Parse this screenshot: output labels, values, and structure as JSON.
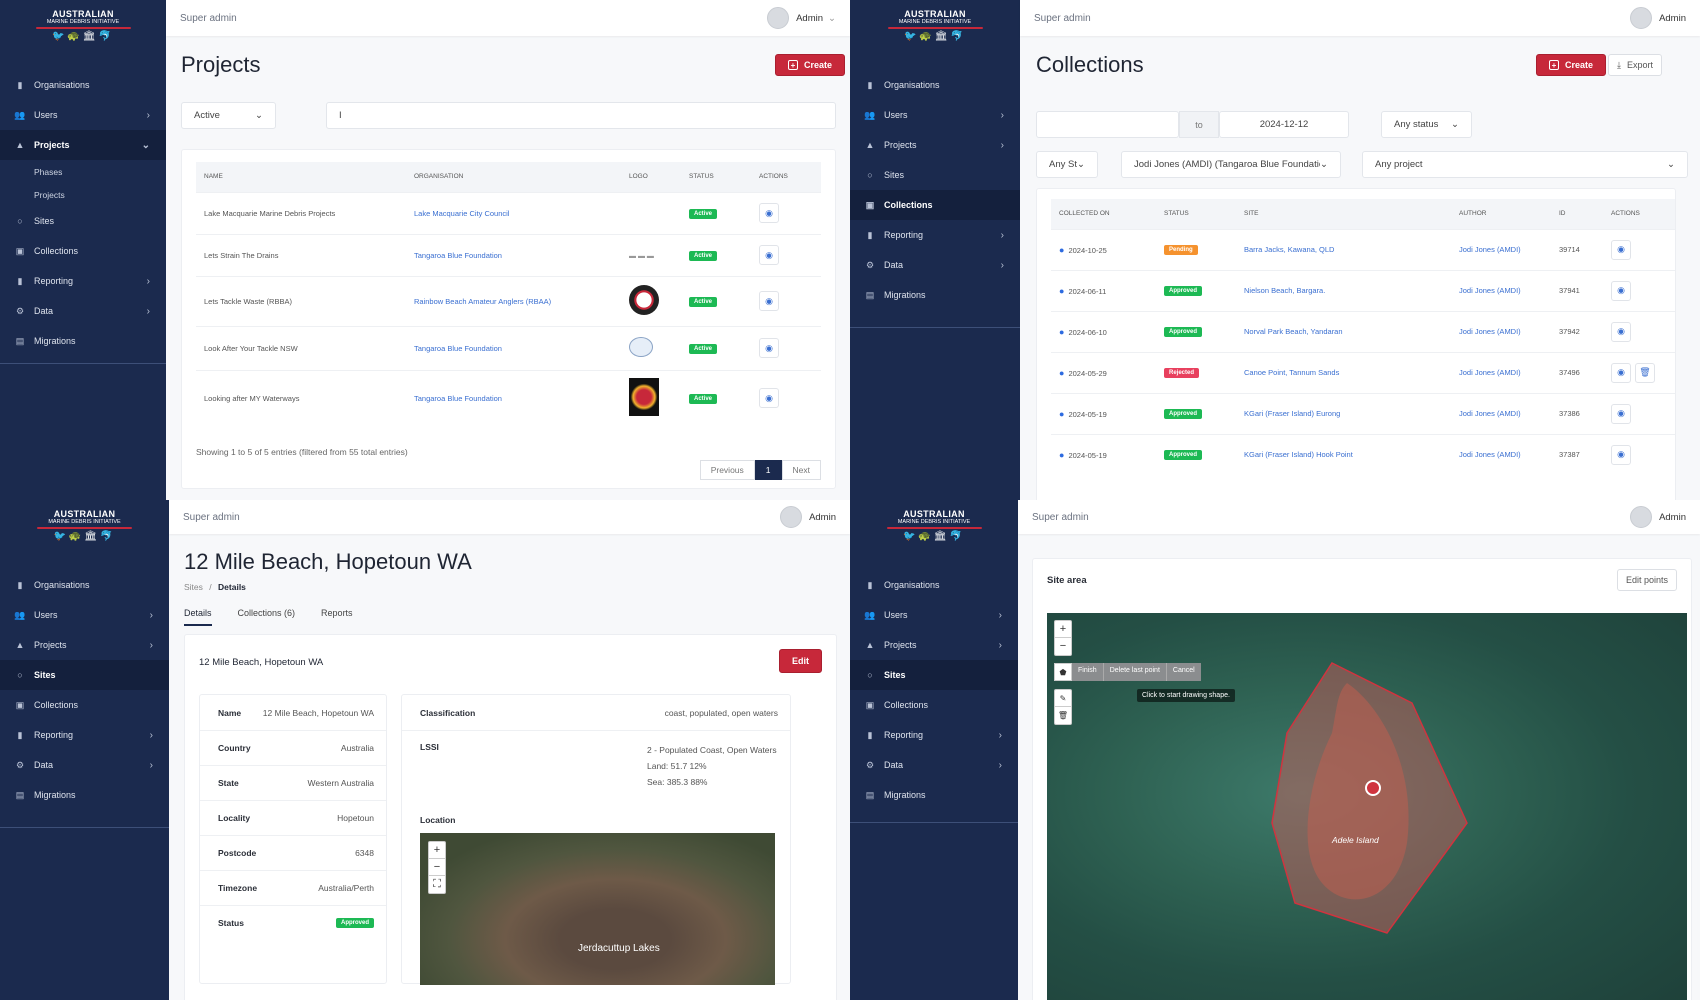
{
  "brand": {
    "line1": "AUSTRALIAN",
    "line2": "MARINE DEBRIS INITIATIVE",
    "emblem": "🐦🐢🏛🐬"
  },
  "common": {
    "super_admin": "Super admin",
    "user": "Admin"
  },
  "nav_icons": {
    "organisations": "▮",
    "users": "👥",
    "projects": "▲",
    "sites": "○",
    "collections": "▣",
    "reporting": "▮",
    "data": "⚙",
    "migrations": "▤",
    "chevron_right": "›",
    "chevron_down": "⌄"
  },
  "nav_labels": {
    "organisations": "Organisations",
    "users": "Users",
    "projects": "Projects",
    "phases": "Phases",
    "projects_sub": "Projects",
    "sites": "Sites",
    "collections": "Collections",
    "reporting": "Reporting",
    "data": "Data",
    "migrations": "Migrations"
  },
  "projects": {
    "title": "Projects",
    "create": "Create",
    "filter_status": "Active",
    "search_value": "I",
    "headers": [
      "NAME",
      "ORGANISATION",
      "LOGO",
      "STATUS",
      "ACTIONS"
    ],
    "rows": [
      {
        "name": "Lake Macquarie Marine Debris Projects",
        "org": "Lake Macquarie City Council",
        "status": "Active"
      },
      {
        "name": "Lets Strain The Drains",
        "org": "Tangaroa Blue Foundation",
        "status": "Active"
      },
      {
        "name": "Lets Tackle Waste (RBBA)",
        "org": "Rainbow Beach Amateur Anglers (RBAA)",
        "status": "Active"
      },
      {
        "name": "Look After Your Tackle NSW",
        "org": "Tangaroa Blue Foundation",
        "status": "Active"
      },
      {
        "name": "Looking after MY Waterways",
        "org": "Tangaroa Blue Foundation",
        "status": "Active"
      }
    ],
    "footer": "Showing 1 to 5 of 5 entries (filtered from 55 total entries)",
    "pager": {
      "prev": "Previous",
      "page": "1",
      "next": "Next"
    }
  },
  "collections": {
    "title": "Collections",
    "create": "Create",
    "export": "Export",
    "date_to_label": "to",
    "date_to": "2024-12-12",
    "status_filter": "Any status",
    "state_filter": "Any St",
    "author_filter": "Jodi Jones (AMDI) (Tangaroa Blue Foundatio",
    "project_filter": "Any project",
    "headers": [
      "COLLECTED ON",
      "STATUS",
      "SITE",
      "AUTHOR",
      "ID",
      "ACTIONS"
    ],
    "rows": [
      {
        "date": "2024-10-25",
        "status": "Pending",
        "site": "Barra Jacks, Kawana, QLD",
        "author": "Jodi Jones (AMDI)",
        "id": "39714",
        "color": "#f5922e"
      },
      {
        "date": "2024-06-11",
        "status": "Approved",
        "site": "Nielson Beach, Bargara.",
        "author": "Jodi Jones (AMDI)",
        "id": "37941",
        "color": "#1db954"
      },
      {
        "date": "2024-06-10",
        "status": "Approved",
        "site": "Norval Park Beach, Yandaran",
        "author": "Jodi Jones (AMDI)",
        "id": "37942",
        "color": "#1db954"
      },
      {
        "date": "2024-05-29",
        "status": "Rejected",
        "site": "Canoe Point, Tannum Sands",
        "author": "Jodi Jones (AMDI)",
        "id": "37496",
        "color": "#e8405e"
      },
      {
        "date": "2024-05-19",
        "status": "Approved",
        "site": "KGari (Fraser Island) Eurong",
        "author": "Jodi Jones (AMDI)",
        "id": "37386",
        "color": "#1db954"
      },
      {
        "date": "2024-05-19",
        "status": "Approved",
        "site": "KGari (Fraser Island) Hook Point",
        "author": "Jodi Jones (AMDI)",
        "id": "37387",
        "color": "#1db954"
      }
    ]
  },
  "site": {
    "title": "12 Mile Beach, Hopetoun WA",
    "breadcrumb": {
      "root": "Sites",
      "sep": "/",
      "current": "Details"
    },
    "tabs": [
      "Details",
      "Collections (6)",
      "Reports"
    ],
    "card_title": "12 Mile Beach, Hopetoun WA",
    "edit": "Edit",
    "fields": [
      {
        "k": "Name",
        "v": "12 Mile Beach, Hopetoun WA"
      },
      {
        "k": "Country",
        "v": "Australia"
      },
      {
        "k": "State",
        "v": "Western Australia"
      },
      {
        "k": "Locality",
        "v": "Hopetoun"
      },
      {
        "k": "Postcode",
        "v": "6348"
      },
      {
        "k": "Timezone",
        "v": "Australia/Perth"
      }
    ],
    "status_label": "Status",
    "status": "Approved",
    "classification_label": "Classification",
    "classification": "coast, populated, open waters",
    "lssi_label": "LSSI",
    "lssi": "2 - Populated Coast, Open Waters",
    "land": "Land: 51.7 12%",
    "sea": "Sea: 385.3 88%",
    "location_label": "Location",
    "map_label": "Jerdacuttup Lakes"
  },
  "site_area": {
    "title": "Site area",
    "edit_points": "Edit points",
    "draw": {
      "finish": "Finish",
      "delete_last": "Delete last point",
      "cancel": "Cancel"
    },
    "tooltip": "Click to start drawing shape.",
    "island": "Adele Island"
  }
}
